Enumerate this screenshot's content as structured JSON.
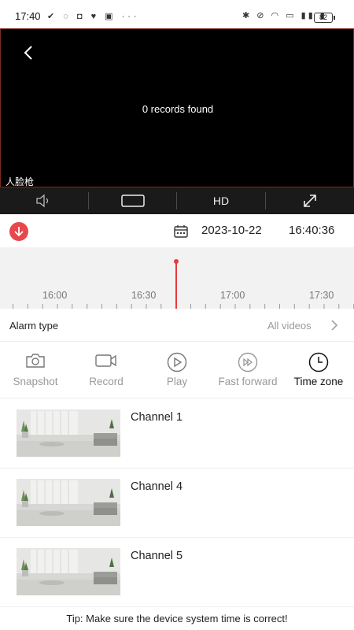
{
  "status_bar": {
    "time": "17:40",
    "battery": "82"
  },
  "video": {
    "message": "0 records found",
    "channel_label": "人脸枪"
  },
  "controls": {
    "hd_label": "HD"
  },
  "date_bar": {
    "date": "2023-10-22",
    "time": "16:40:36"
  },
  "timeline": {
    "ticks": [
      "16:00",
      "16:30",
      "17:00",
      "17:30"
    ]
  },
  "alarm": {
    "label": "Alarm type",
    "value": "All videos"
  },
  "actions": [
    {
      "label": "Snapshot",
      "icon": "camera-icon"
    },
    {
      "label": "Record",
      "icon": "video-camera-icon"
    },
    {
      "label": "Play",
      "icon": "play-icon"
    },
    {
      "label": "Fast forward",
      "icon": "fast-forward-icon"
    },
    {
      "label": "Time zone",
      "icon": "clock-icon"
    }
  ],
  "channels": [
    {
      "name": "Channel 1"
    },
    {
      "name": "Channel 4"
    },
    {
      "name": "Channel 5"
    }
  ],
  "tip": "Tip: Make sure the device system time is correct!",
  "colors": {
    "accent_red": "#e83a3a",
    "video_bg": "#000000",
    "controls_bg": "#1a1a1a",
    "timeline_bg": "#f2f2f2"
  }
}
